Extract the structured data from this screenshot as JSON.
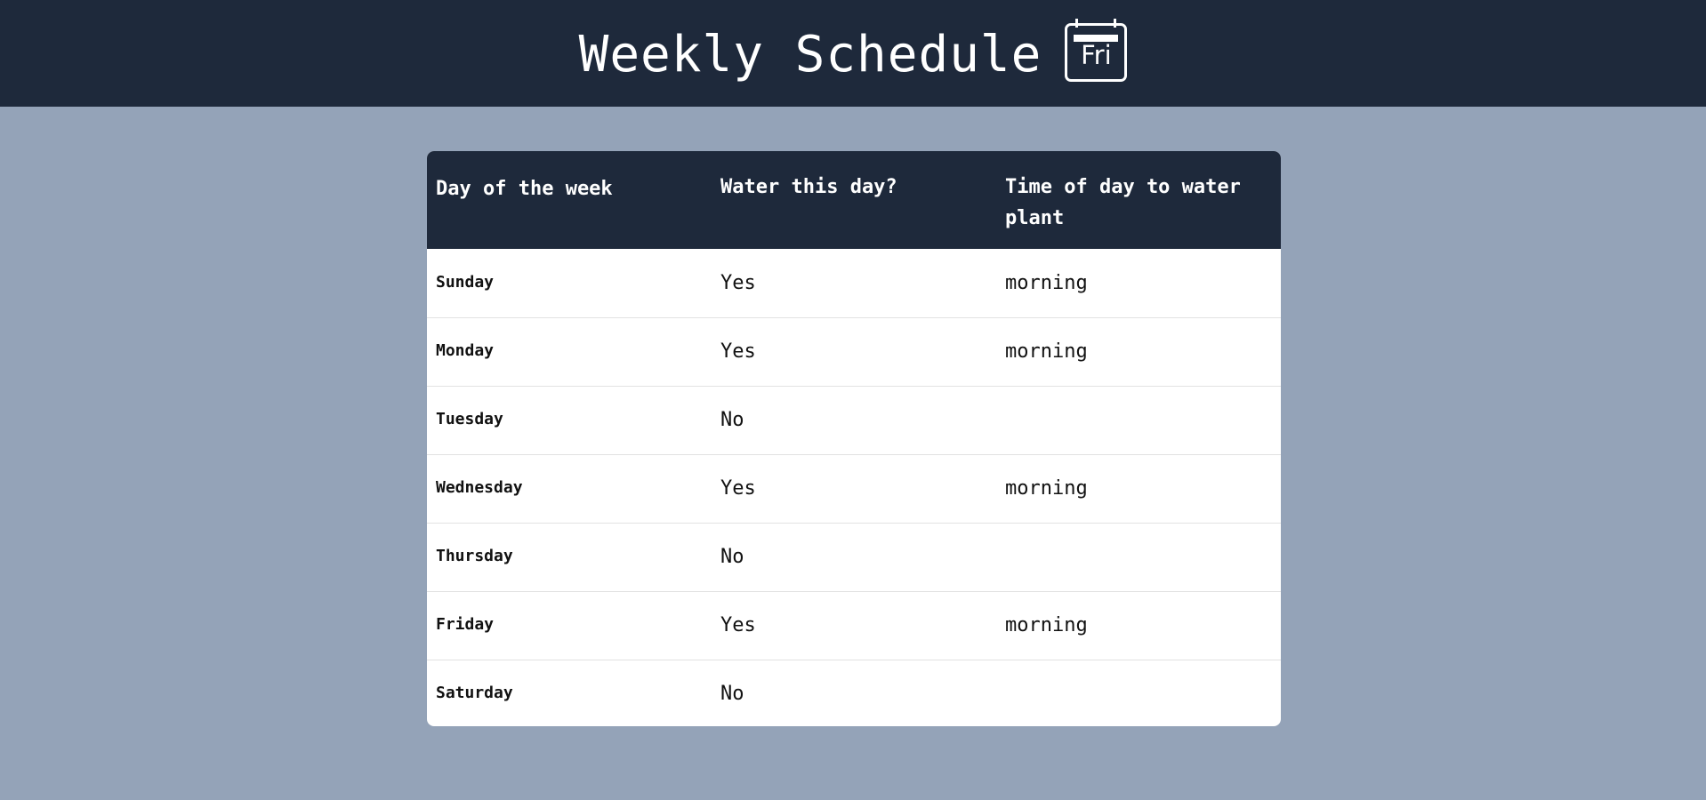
{
  "header": {
    "title": "Weekly Schedule",
    "calendar_icon_label": "Fri",
    "background": "#1e293b"
  },
  "page": {
    "background": "#94a3b8"
  },
  "table": {
    "headers": [
      "Day of the week",
      "Water this day?",
      "Time of day to water plant"
    ],
    "rows": [
      {
        "day": "Sunday",
        "water": "Yes",
        "time": "morning"
      },
      {
        "day": "Monday",
        "water": "Yes",
        "time": "morning"
      },
      {
        "day": "Tuesday",
        "water": "No",
        "time": ""
      },
      {
        "day": "Wednesday",
        "water": "Yes",
        "time": "morning"
      },
      {
        "day": "Thursday",
        "water": "No",
        "time": ""
      },
      {
        "day": "Friday",
        "water": "Yes",
        "time": "morning"
      },
      {
        "day": "Saturday",
        "water": "No",
        "time": ""
      }
    ]
  }
}
